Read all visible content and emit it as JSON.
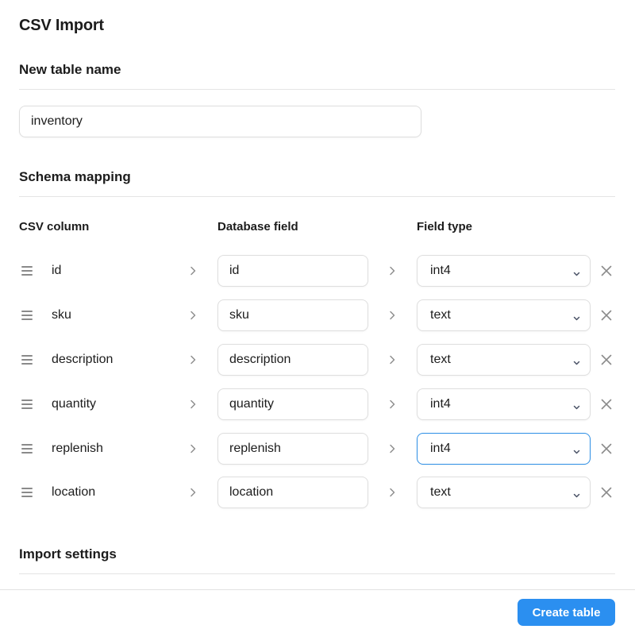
{
  "title": "CSV Import",
  "sections": {
    "table_name": {
      "heading": "New table name",
      "value": "inventory"
    },
    "schema": {
      "heading": "Schema mapping",
      "headers": {
        "csv_column": "CSV column",
        "database_field": "Database field",
        "field_type": "Field type"
      },
      "rows": [
        {
          "csv": "id",
          "field": "id",
          "type": "int4",
          "focused": false
        },
        {
          "csv": "sku",
          "field": "sku",
          "type": "text",
          "focused": false
        },
        {
          "csv": "description",
          "field": "description",
          "type": "text",
          "focused": false
        },
        {
          "csv": "quantity",
          "field": "quantity",
          "type": "int4",
          "focused": false
        },
        {
          "csv": "replenish",
          "field": "replenish",
          "type": "int4",
          "focused": true
        },
        {
          "csv": "location",
          "field": "location",
          "type": "text",
          "focused": false
        }
      ]
    },
    "import_settings": {
      "heading": "Import settings"
    }
  },
  "footer": {
    "create_label": "Create table"
  },
  "icons": {
    "drag": "drag-handle-icon",
    "arrow": "chevron-right-icon",
    "dropdown": "chevron-down-icon",
    "remove": "close-icon"
  },
  "colors": {
    "accent": "#2b8ff0",
    "focus_border": "#2d8fe6"
  }
}
